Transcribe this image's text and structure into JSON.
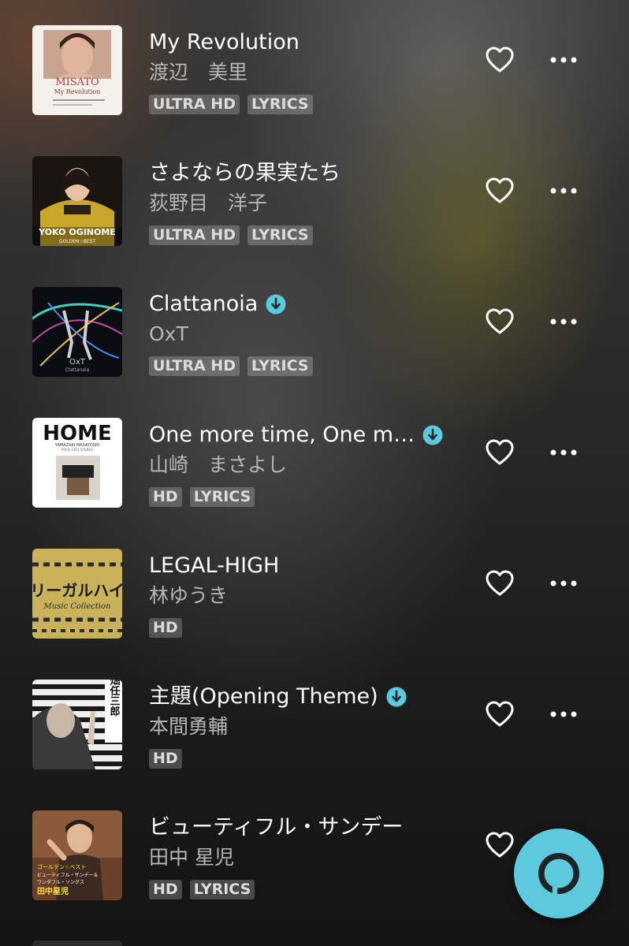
{
  "tracks": [
    {
      "title": "My Revolution",
      "artist": "渡辺　美里",
      "badges": [
        "ULTRA HD",
        "LYRICS"
      ],
      "downloaded": false,
      "art_text": [
        "MISATO",
        "My Revolution"
      ]
    },
    {
      "title": "さよならの果実たち",
      "artist": "荻野目　洋子",
      "badges": [
        "ULTRA HD",
        "LYRICS"
      ],
      "downloaded": false,
      "art_text": [
        "YOKO OGINOME",
        "GOLDEN☆BEST"
      ]
    },
    {
      "title": "Clattanoia",
      "artist": "OxT",
      "badges": [
        "ULTRA HD",
        "LYRICS"
      ],
      "downloaded": true,
      "art_text": [
        "OxT",
        "Clattanoia"
      ]
    },
    {
      "title": "One more time, One m…",
      "artist": "山崎　まさよし",
      "badges": [
        "HD",
        "LYRICS"
      ],
      "downloaded": true,
      "art_text": [
        "HOME",
        "YAMAZAKI MASAYOSHI",
        "POCH-1621 STEREO"
      ]
    },
    {
      "title": "LEGAL-HIGH",
      "artist": "林ゆうき",
      "badges": [
        "HD"
      ],
      "downloaded": false,
      "art_text": [
        "リーガルハイ",
        "Music Collection"
      ]
    },
    {
      "title": "主題(Opening Theme)",
      "artist": "本間勇輔",
      "badges": [
        "HD"
      ],
      "downloaded": true,
      "art_text": [
        "古畑任三郎"
      ]
    },
    {
      "title": "ビューティフル・サンデー",
      "artist": "田中 星児",
      "badges": [
        "HD",
        "LYRICS"
      ],
      "downloaded": false,
      "art_text": [
        "ゴールデン☆ベスト",
        "ビューティフル・サンデー＆",
        "ワンダフル・ソングス",
        "田中星児"
      ]
    }
  ],
  "icons": {
    "heart": "heart-outline-icon",
    "more": "more-dots-icon",
    "download": "downloaded-icon",
    "alexa": "alexa-icon"
  },
  "colors": {
    "accent": "#5cc9dc",
    "text_primary": "#ffffff",
    "text_secondary": "#b7b7b7",
    "badge_bg": "rgba(255,255,255,0.22)"
  }
}
